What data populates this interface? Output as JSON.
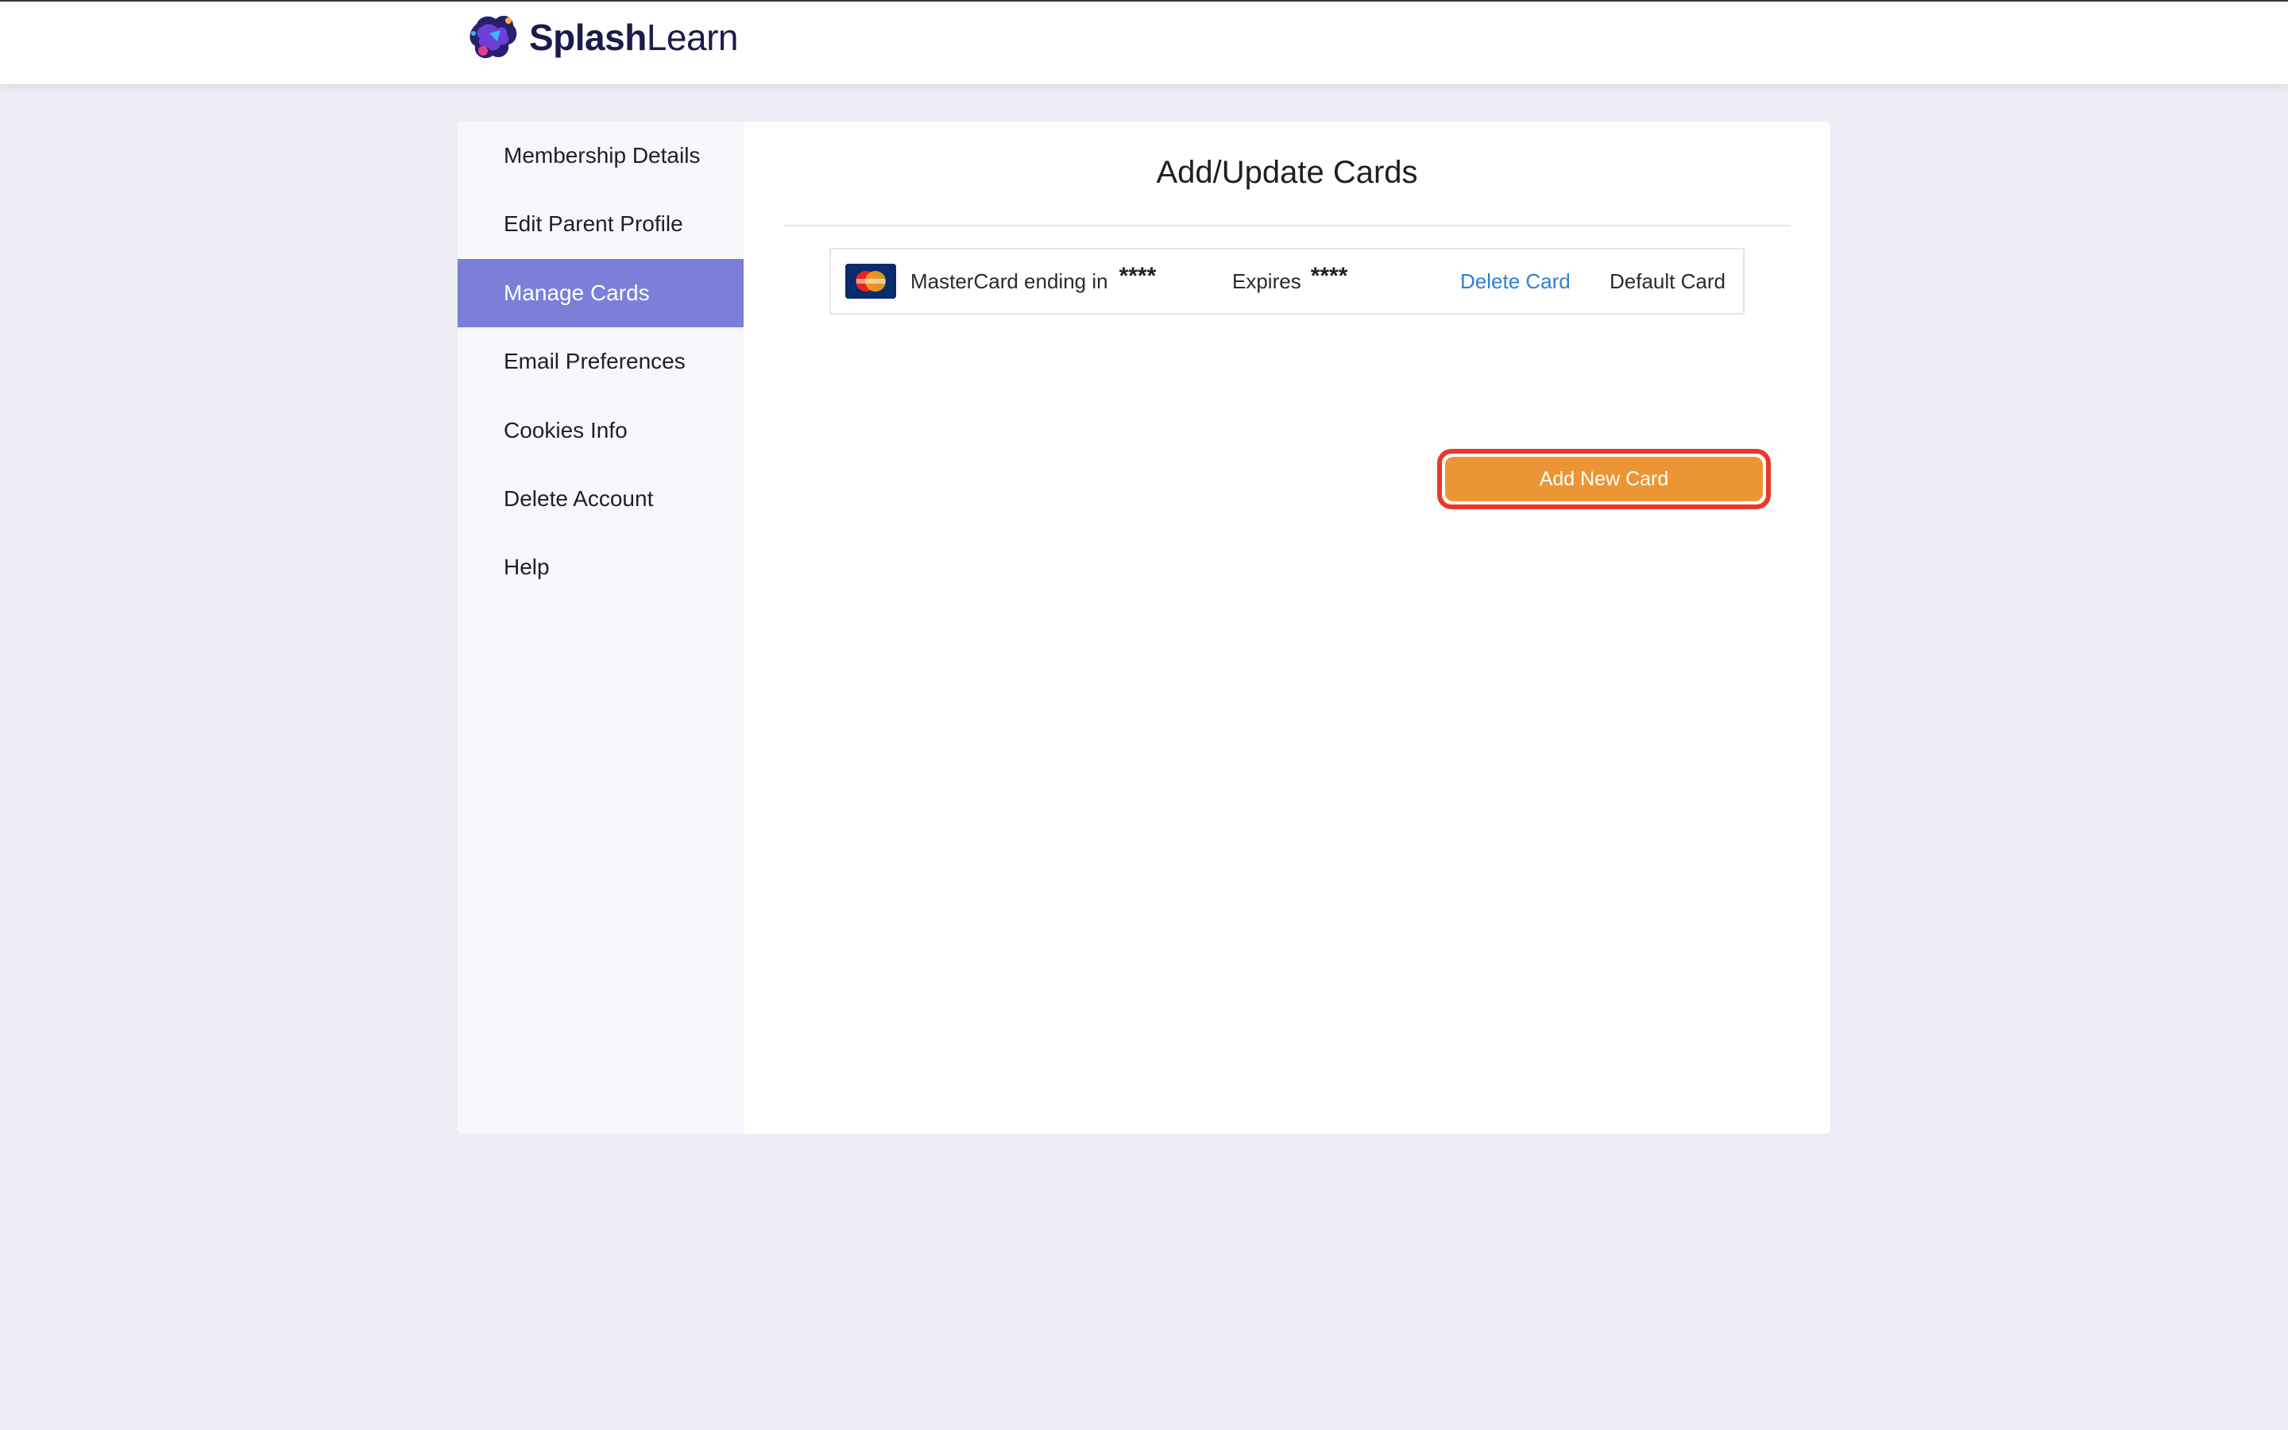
{
  "header": {
    "logo_text_bold": "Splash",
    "logo_text_light": "Learn"
  },
  "sidebar": {
    "items": [
      {
        "label": "Membership Details",
        "active": false
      },
      {
        "label": "Edit Parent Profile",
        "active": false
      },
      {
        "label": "Manage Cards",
        "active": true
      },
      {
        "label": "Email Preferences",
        "active": false
      },
      {
        "label": "Cookies Info",
        "active": false
      },
      {
        "label": "Delete Account",
        "active": false
      },
      {
        "label": "Help",
        "active": false
      }
    ]
  },
  "main": {
    "title": "Add/Update Cards",
    "card": {
      "brand_icon": "mastercard-icon",
      "ending_label": "MasterCard ending in",
      "ending_value": "****",
      "expires_label": "Expires",
      "expires_value": "****",
      "delete_label": "Delete Card",
      "default_label": "Default Card"
    },
    "add_button_label": "Add New Card"
  },
  "colors": {
    "accent": "#7b7fd8",
    "button": "#ec9535",
    "highlight_border": "#e8382b",
    "link": "#2f7fd1",
    "background": "#ededf5"
  }
}
